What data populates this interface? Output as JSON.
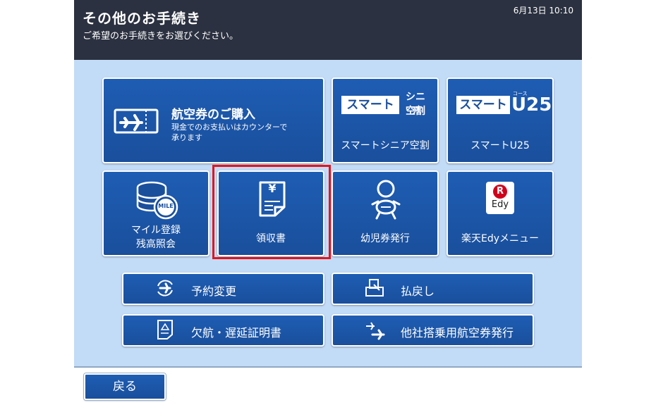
{
  "header": {
    "title": "その他のお手続き",
    "subtitle": "ご希望のお手続きをお選びください。",
    "datetime": "6月13日 10:10"
  },
  "tiles": {
    "ticket_purchase": {
      "title": "航空券のご購入",
      "desc_line1": "現金でのお支払いはカウンターで",
      "desc_line2": "承ります",
      "icon": "airplane-ticket-icon"
    },
    "smart_senior": {
      "label": "スマートシニア空割",
      "logo_main": "スマート",
      "logo_sub1": "シニア",
      "logo_sub2": "空割"
    },
    "smart_u25": {
      "label": "スマートU25",
      "logo_main": "スマート",
      "logo_sub": "U25",
      "logo_tiny": "コース"
    },
    "mile": {
      "label_line1": "マイル登録",
      "label_line2": "残高照会",
      "coin_text": "MILE"
    },
    "receipt": {
      "label": "領収書",
      "icon_text": "¥"
    },
    "infant": {
      "label": "幼児券発行"
    },
    "edy": {
      "label": "楽天Edyメニュー",
      "logo_r": "R",
      "logo_text": "Edy"
    }
  },
  "buttons": {
    "change": {
      "label": "予約変更"
    },
    "refund": {
      "label": "払戻し"
    },
    "certificate": {
      "label": "欠航・遅延証明書"
    },
    "other_airline": {
      "label": "他社搭乗用航空券発行"
    }
  },
  "footer": {
    "back_label": "戻る"
  },
  "colors": {
    "header_bg": "#2b3140",
    "content_bg": "#c2dbf7",
    "button_blue": "#1a4f9c",
    "highlight_red": "#e5141b"
  }
}
